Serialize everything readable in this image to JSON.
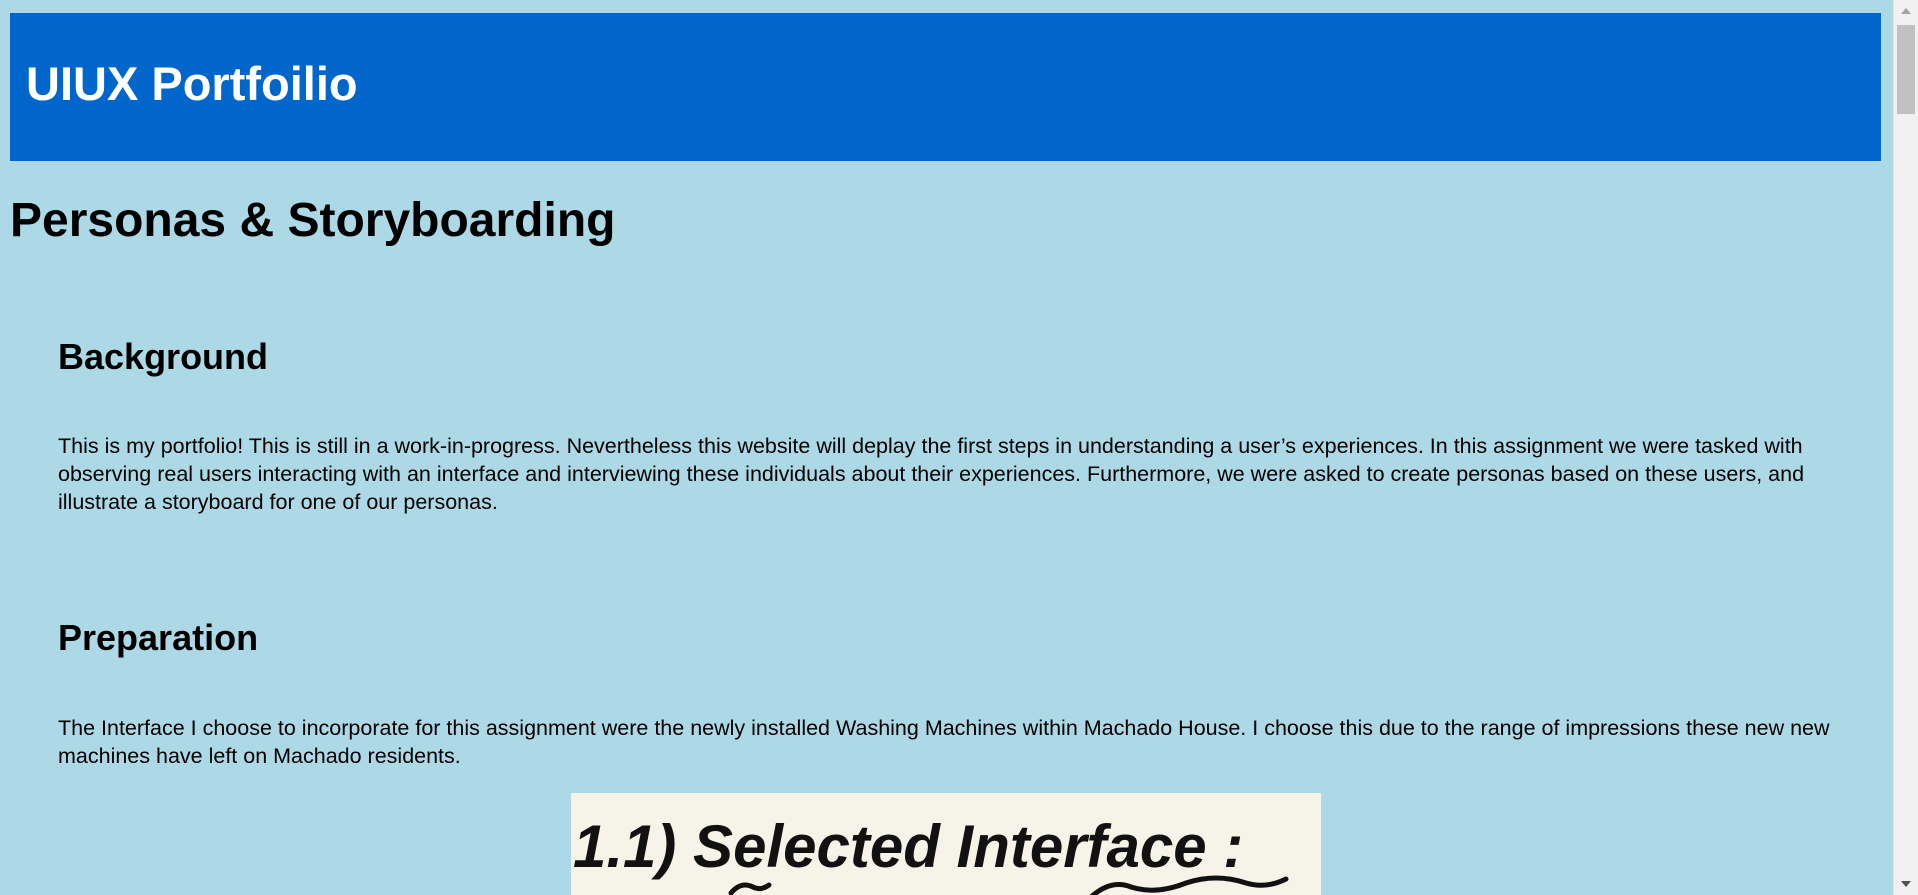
{
  "header": {
    "title": "UIUX Portfoilio"
  },
  "page": {
    "title": "Personas & Storyboarding"
  },
  "sections": [
    {
      "heading": "Background",
      "text": "This is my portfolio! This is still in a work-in-progress. Nevertheless this website will deplay the first steps in understanding a user’s experiences. In this assignment we were tasked with observing real users interacting with an interface and interviewing these individuals about their experiences. Furthermore, we were asked to create personas based on these users, and illustrate a storyboard for one of our personas."
    },
    {
      "heading": "Preparation",
      "text": "The Interface I choose to incorporate for this assignment were the newly installed Washing Machines within Machado House. I choose this due to the range of impressions these new new machines have left on Machado residents."
    }
  ],
  "sketch": {
    "handwritten_text": "1.1) Selected Interface :"
  },
  "colors": {
    "background": "#add8e6",
    "header_bg": "#0066cc",
    "header_text": "#ffffff",
    "sketch_paper": "#f6f4e8"
  },
  "icons": {
    "scroll_up": "chevron-up-icon",
    "scroll_down": "chevron-down-icon"
  }
}
